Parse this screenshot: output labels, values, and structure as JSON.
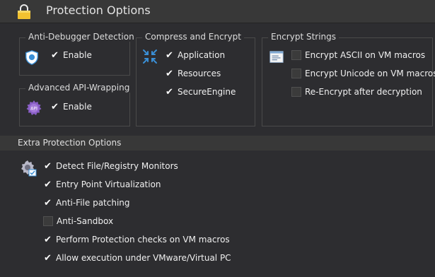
{
  "header": {
    "title": "Protection Options"
  },
  "anti_debugger": {
    "title": "Anti-Debugger Detection",
    "enable_label": "Enable",
    "checked": true
  },
  "api_wrapping": {
    "title": "Advanced API-Wrapping",
    "enable_label": "Enable",
    "checked": true,
    "icon_label": "API"
  },
  "compress": {
    "title": "Compress and Encrypt",
    "items": [
      {
        "label": "Application",
        "checked": true
      },
      {
        "label": "Resources",
        "checked": true
      },
      {
        "label": "SecureEngine",
        "checked": true
      }
    ]
  },
  "encrypt_strings": {
    "title": "Encrypt Strings",
    "items": [
      {
        "label": "Encrypt ASCII on VM macros",
        "checked": false
      },
      {
        "label": "Encrypt Unicode on VM macros",
        "checked": false
      },
      {
        "label": "Re-Encrypt after decryption",
        "checked": false
      }
    ]
  },
  "extra": {
    "title": "Extra Protection Options",
    "items": [
      {
        "label": "Detect File/Registry Monitors",
        "checked": true
      },
      {
        "label": "Entry Point Virtualization",
        "checked": true
      },
      {
        "label": "Anti-File patching",
        "checked": true
      },
      {
        "label": "Anti-Sandbox",
        "checked": false
      },
      {
        "label": "Perform Protection checks on VM macros",
        "checked": true
      },
      {
        "label": "Allow execution under VMware/Virtual PC",
        "checked": true
      }
    ]
  },
  "colors": {
    "background": "#2d2d30",
    "header": "#383838",
    "border": "#4a4a4a",
    "lock": "#f2c230",
    "shield": "#3a8fd6"
  }
}
